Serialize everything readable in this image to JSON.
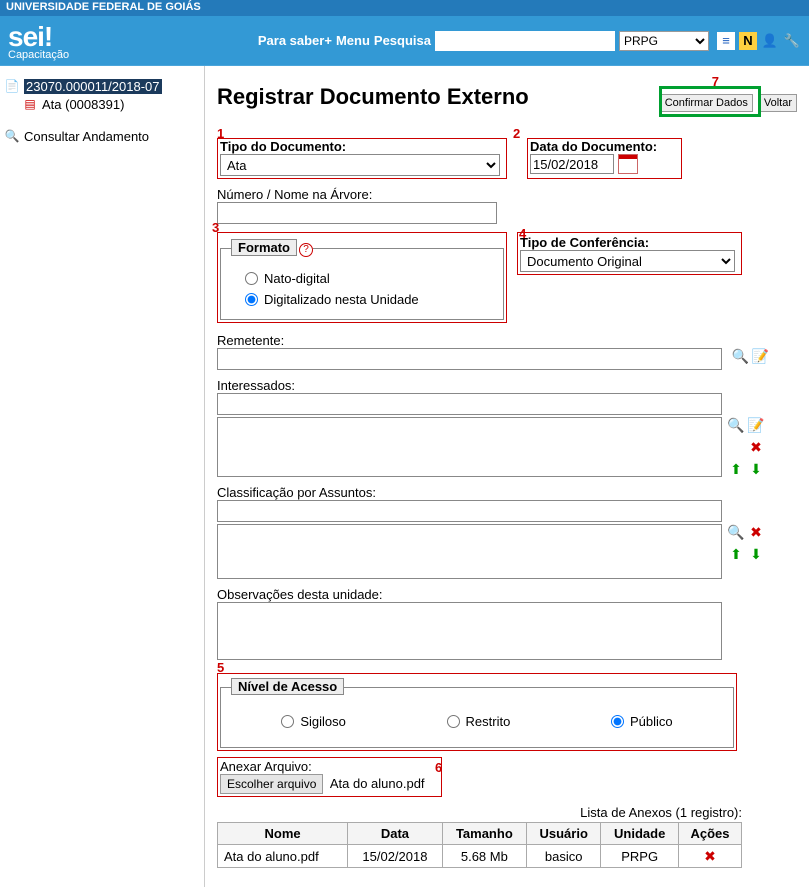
{
  "topbar": {
    "org": "UNIVERSIDADE FEDERAL DE GOIÁS"
  },
  "header": {
    "logo": "sei!",
    "sub": "Capacitação",
    "para_saber": "Para saber+",
    "menu": "Menu",
    "pesquisa": "Pesquisa",
    "search_value": "",
    "unit": "PRPG",
    "icons": {
      "list": "list-icon",
      "novo": "N",
      "user": "user-icon",
      "key": "key-icon"
    }
  },
  "sidebar": {
    "processo": "23070.000011/2018-07",
    "doc": "Ata (0008391)",
    "consultar": "Consultar Andamento"
  },
  "main": {
    "title": "Registrar Documento Externo",
    "confirmar": "Confirmar Dados",
    "voltar": "Voltar",
    "markers": {
      "m1": "1",
      "m2": "2",
      "m3": "3",
      "m4": "4",
      "m5": "5",
      "m6": "6",
      "m7": "7"
    },
    "tipo_label": "Tipo do Documento:",
    "tipo_value": "Ata",
    "data_label": "Data do Documento:",
    "data_value": "15/02/2018",
    "numero_label": "Número / Nome na Árvore:",
    "numero_value": "",
    "formato_legend": "Formato",
    "formato_opt1": "Nato-digital",
    "formato_opt2": "Digitalizado nesta Unidade",
    "tipoconf_label": "Tipo de Conferência:",
    "tipoconf_value": "Documento Original",
    "remetente_label": "Remetente:",
    "remetente_value": "",
    "interessados_label": "Interessados:",
    "interessados_value": "",
    "classificacao_label": "Classificação por Assuntos:",
    "classificacao_value": "",
    "obs_label": "Observações desta unidade:",
    "obs_value": "",
    "nivel_legend": "Nível de Acesso",
    "nivel_opt1": "Sigiloso",
    "nivel_opt2": "Restrito",
    "nivel_opt3": "Público",
    "anexar_label": "Anexar Arquivo:",
    "anexar_btn": "Escolher arquivo",
    "anexar_file": "Ata do aluno.pdf",
    "anexos_title": "Lista de Anexos (1 registro):",
    "anexos_headers": {
      "nome": "Nome",
      "data": "Data",
      "tamanho": "Tamanho",
      "usuario": "Usuário",
      "unidade": "Unidade",
      "acoes": "Ações"
    },
    "anexos_row": {
      "nome": "Ata do aluno.pdf",
      "data": "15/02/2018",
      "tamanho": "5.68 Mb",
      "usuario": "basico",
      "unidade": "PRPG"
    }
  }
}
